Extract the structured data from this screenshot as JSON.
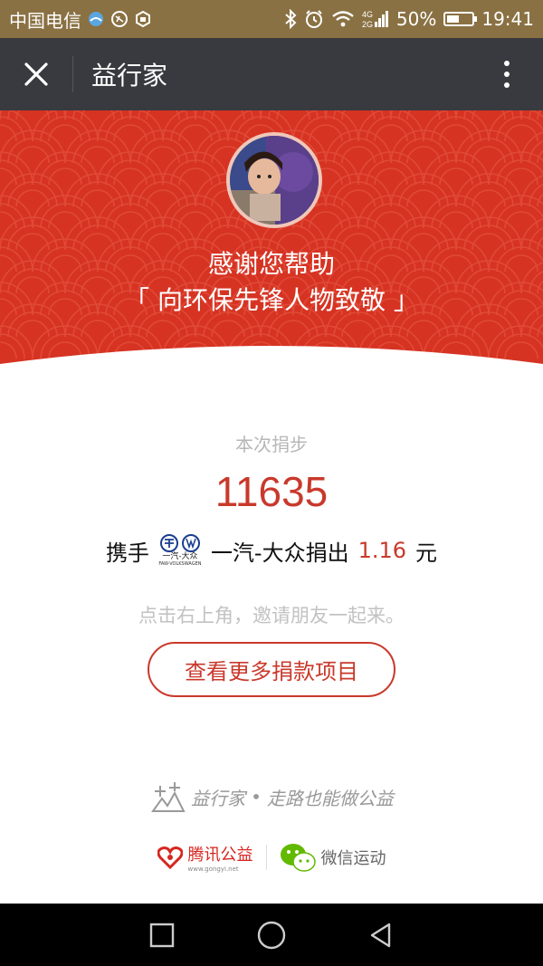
{
  "status_bar": {
    "carrier": "中国电信",
    "battery": "50%",
    "battery_level": 0.5,
    "time": "19:41",
    "network": "4G",
    "network2": "2G"
  },
  "title_bar": {
    "title": "益行家"
  },
  "header": {
    "thanks": "感谢您帮助",
    "campaign": "「 向环保先锋人物致敬 」"
  },
  "content": {
    "donate_label": "本次捐步",
    "steps": "11635",
    "line_prefix": "携手",
    "brand_logo_text": "一汽-大众",
    "brand_logo_sub": "FAW-VOLKSWAGEN",
    "brand_name": "一汽-大众捐出",
    "amount": "1.16",
    "currency": "元",
    "invite": "点击右上角，邀请朋友一起来。",
    "more_projects": "查看更多捐款项目"
  },
  "footer": {
    "slogan_brand": "益行家",
    "slogan_sep": "•",
    "slogan_text": "走路也能做公益",
    "tencent": "腾讯公益",
    "tencent_url": "www.gongyi.net",
    "wechat": "微信运动"
  },
  "colors": {
    "accent": "#c9392b",
    "header_red": "#d63323",
    "title_bar": "#393a3f",
    "status_bar": "#8a7143"
  }
}
